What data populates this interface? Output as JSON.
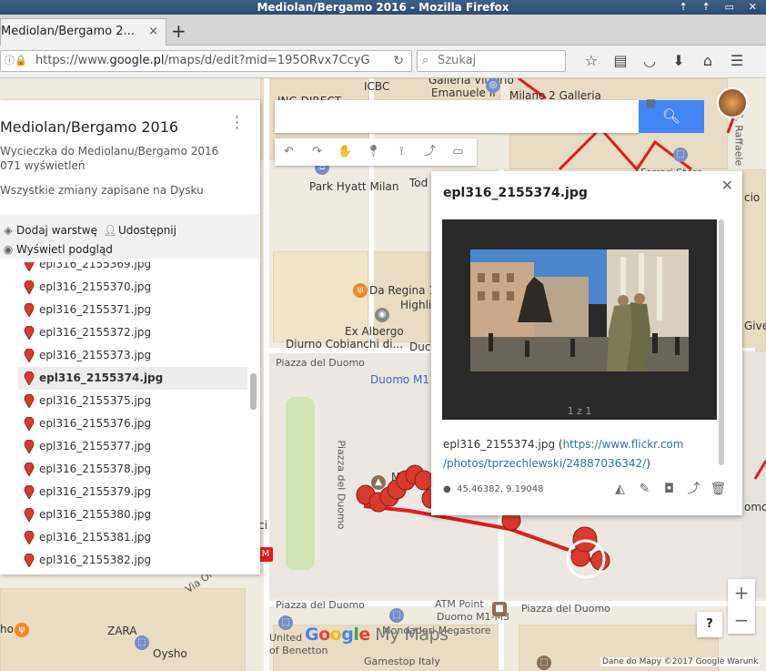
{
  "window": {
    "title": "Mediolan/Bergamo 2016 - Mozilla Firefox",
    "controls": "⇡ ⇡ ▭ ✕"
  },
  "tab": {
    "title": "Mediolan/Bergamo 2...",
    "close": "×",
    "new_tab": "+"
  },
  "address_bar": {
    "url_prefix": "https://www.",
    "url_domain": "google.pl",
    "url_rest": "/maps/d/edit?mid=195ORvx7CcyG"
  },
  "search_bar": {
    "placeholder": "Szukaj"
  },
  "map_labels": {
    "ing_direct": "ING DIRECT",
    "icbc": "ICBC",
    "galleria_1": "Galleria Vittorio",
    "galleria_2": "Emanuele II",
    "milano2": "Milano 2 Galleria",
    "park_hyatt": "Park Hyatt Milan",
    "tod": "Tod",
    "ferrari": "Ferrari Store",
    "da_regina_1": "Da Regina 1",
    "highli": "Highli",
    "ex_albergo_1": "Ex Albergo",
    "ex_albergo_2": "Diurno Cobianchi di...",
    "duc": "Duc",
    "piazza_duomo_top": "Piazza del Duomo",
    "duomo_m1": "Duomo M1",
    "piazza_duomo_vertical": "Piazza del Duomo",
    "monum": "Monum",
    "via_orefici": "Via Orefici",
    "piazza_duomo_bottom_left": "Piazza del Duomo",
    "atm_point_1": "ATM Point",
    "atm_point_2": "Duomo M1-M3",
    "piazza_duomo_bottom_right": "Piazza del Duomo",
    "zara": "ZARA",
    "mondadori": "Mondadori Megastore",
    "united_1": "United",
    "united_2": "of Benetton",
    "oysho": "Oysho",
    "gamestop": "Gamestop Italy",
    "via_raffaele": "Via S. Raffaele",
    "give": "Give",
    "omo": "omo",
    "ci": "ci",
    "cio": "cio",
    "ho": "ho",
    "v": "V"
  },
  "panel": {
    "title": "Mediolan/Bergamo 2016",
    "description": "Wycieczka do Mediolanu/Bergamo 2016",
    "views": "071 wyświetleń",
    "saved": "Wszystkie zmiany zapisane na Dysku",
    "add_layer": "Dodaj warstwę",
    "share": "Udostępnij",
    "preview": "Wyświetl podgląd",
    "items": [
      "epl316_2155369.jpg",
      "epl316_2155370.jpg",
      "epl316_2155371.jpg",
      "epl316_2155372.jpg",
      "epl316_2155373.jpg",
      "epl316_2155374.jpg",
      "epl316_2155375.jpg",
      "epl316_2155376.jpg",
      "epl316_2155377.jpg",
      "epl316_2155378.jpg",
      "epl316_2155379.jpg",
      "epl316_2155380.jpg",
      "epl316_2155381.jpg",
      "epl316_2155382.jpg"
    ],
    "selected_item": "epl316_2155374.jpg"
  },
  "info_window": {
    "title": "epl316_2155374.jpg",
    "photo_counter": "1 z 1",
    "caption_name": "epl316_2155374.jpg (",
    "caption_link": "https://www.flickr.com/photos/tprzechlewski/24887036342/",
    "caption_end": ")",
    "coordinates": "45.46382, 9.19048"
  },
  "map_controls": {
    "zoom_in": "+",
    "zoom_out": "−",
    "help": "?",
    "attribution": "Dane do Mapy ©2017 Google   Warunk",
    "logo": "Google My Maps"
  },
  "colors": {
    "route_red": "#e31b1b",
    "marker_red": "#d93a2e",
    "google_blue": "#4285f4",
    "link_blue": "#2a6fbe"
  }
}
